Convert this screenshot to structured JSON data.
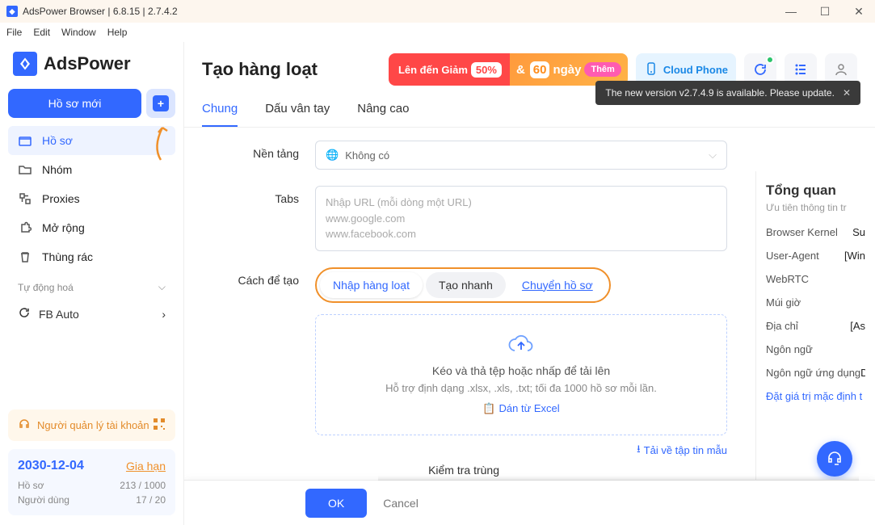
{
  "window": {
    "title": "AdsPower Browser | 6.8.15 | 2.7.4.2"
  },
  "menu": {
    "file": "File",
    "edit": "Edit",
    "window": "Window",
    "help": "Help"
  },
  "brand": "AdsPower",
  "sidebar": {
    "new_profile": "Hồ sơ mới",
    "items": [
      {
        "label": "Hồ sơ",
        "icon": "folder"
      },
      {
        "label": "Nhóm",
        "icon": "folder-open"
      },
      {
        "label": "Proxies",
        "icon": "proxy"
      },
      {
        "label": "Mở rộng",
        "icon": "puzzle"
      },
      {
        "label": "Thùng rác",
        "icon": "trash"
      }
    ],
    "automation_label": "Tự động hoá",
    "fb_auto": "FB Auto",
    "account_manager": "Người quản lý tài khoản",
    "stats": {
      "date": "2030-12-04",
      "renew": "Gia hạn",
      "profiles_label": "Hồ sơ",
      "profiles_value": "213 / 1000",
      "users_label": "Người dùng",
      "users_value": "17 / 20"
    }
  },
  "header": {
    "title": "Tạo hàng loạt",
    "promo_lead": "Lên đến Giảm",
    "promo_50": "50%",
    "promo_60": "60",
    "promo_days": "ngày",
    "promo_more": "Thêm",
    "cloud_phone": "Cloud Phone"
  },
  "notice": {
    "text": "The new version v2.7.4.9 is available. Please update."
  },
  "tabs": {
    "general": "Chung",
    "fingerprint": "Dấu vân tay",
    "advanced": "Nâng cao"
  },
  "form": {
    "platform_label": "Nền tảng",
    "platform_value": "Không có",
    "tabs_label": "Tabs",
    "tabs_placeholder": "Nhập URL (mỗi dòng một URL)\nwww.google.com\nwww.facebook.com",
    "create_label": "Cách để tạo",
    "seg_batch": "Nhập hàng loạt",
    "seg_quick": "Tạo nhanh",
    "seg_transfer": "Chuyển hồ sơ",
    "dz_title": "Kéo và thả tệp hoặc nhấp để tải lên",
    "dz_sub": "Hỗ trợ định dạng .xlsx, .xls, .txt; tối đa 1000 hồ sơ mỗi lần.",
    "dz_paste": "Dán từ Excel",
    "sample": "Tải về tập tin mẫu",
    "dup_label": "Kiểm tra trùng"
  },
  "overview": {
    "title": "Tổng quan",
    "subtitle": "Ưu tiên thông tin tr",
    "rows": [
      {
        "k": "Browser Kernel",
        "v": "Su"
      },
      {
        "k": "User-Agent",
        "v": "[Win"
      },
      {
        "k": "WebRTC",
        "v": ""
      },
      {
        "k": "Múi giờ",
        "v": ""
      },
      {
        "k": "Địa chỉ",
        "v": "[As"
      },
      {
        "k": "Ngôn ngữ",
        "v": ""
      },
      {
        "k": "Ngôn ngữ ứng dụng",
        "v": "Dự"
      }
    ],
    "defaults": "Đặt giá trị mặc định t"
  },
  "footer": {
    "ok": "OK",
    "cancel": "Cancel"
  }
}
